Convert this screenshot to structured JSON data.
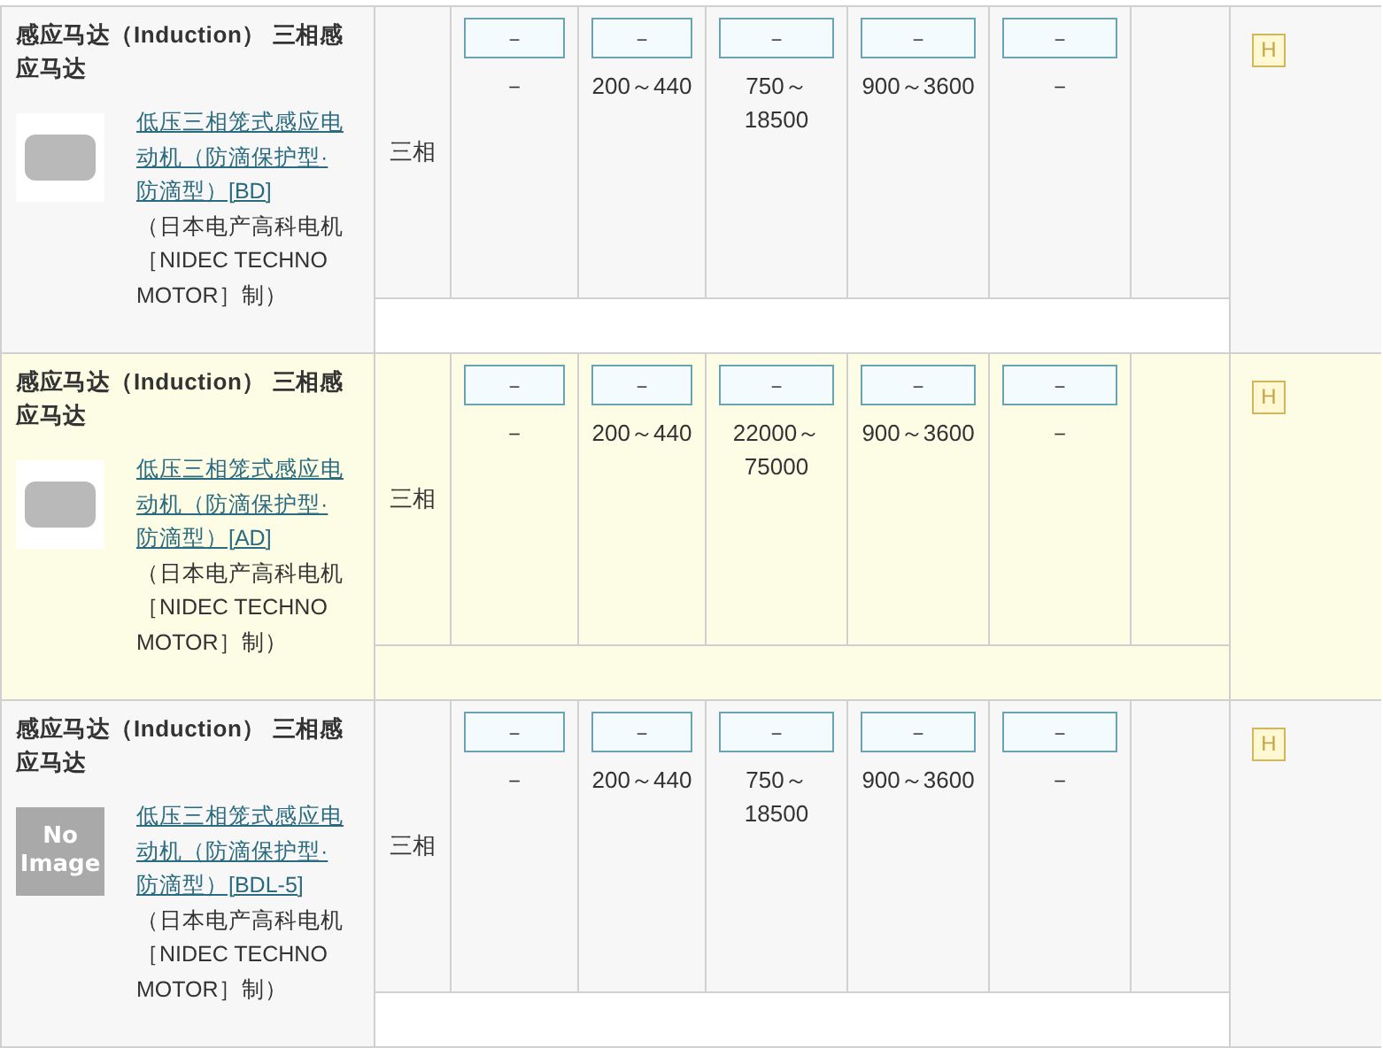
{
  "rows": [
    {
      "highlighted": false,
      "title": "感应马达（Induction） 三相感应马达",
      "image": {
        "kind": "photo"
      },
      "link": "低压三相笼式感应电动机（防滴保护型·防滴型）[BD]",
      "maker": "（日本电产高科电机［NIDEC TECHNO MOTOR］制）",
      "phase": "三相",
      "buttons": [
        "－",
        "－",
        "－",
        "－",
        "－"
      ],
      "values": [
        "－",
        "200～440",
        "750～18500",
        "900～3600",
        "－"
      ],
      "badge": "H"
    },
    {
      "highlighted": true,
      "title": "感应马达（Induction） 三相感应马达",
      "image": {
        "kind": "photo"
      },
      "link": "低压三相笼式感应电动机（防滴保护型·防滴型）[AD]",
      "maker": "（日本电产高科电机［NIDEC TECHNO MOTOR］制）",
      "phase": "三相",
      "buttons": [
        "－",
        "－",
        "－",
        "－",
        "－"
      ],
      "values": [
        "－",
        "200～440",
        "22000～75000",
        "900～3600",
        "－"
      ],
      "badge": "H"
    },
    {
      "highlighted": false,
      "title": "感应马达（Induction） 三相感应马达",
      "image": {
        "kind": "placeholder",
        "text": "No Image"
      },
      "link": "低压三相笼式感应电动机（防滴保护型·防滴型）[BDL-5]",
      "maker": "（日本电产高科电机［NIDEC TECHNO MOTOR］制）",
      "phase": "三相",
      "buttons": [
        "－",
        "－",
        "－",
        "－",
        "－"
      ],
      "values": [
        "－",
        "200～440",
        "750～18500",
        "900～3600",
        "－"
      ],
      "badge": "H"
    }
  ]
}
